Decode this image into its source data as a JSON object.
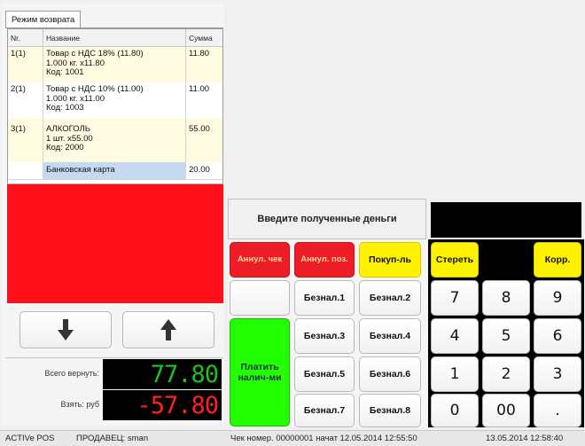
{
  "window": {
    "tab_label": "Режим возврата"
  },
  "receipt": {
    "columns": {
      "nr": "Nr.",
      "name": "Название",
      "sum": "Сумма"
    },
    "items": [
      {
        "nr": "1(1)",
        "line1": "Товар с НДС 18% (11.80)",
        "line2": "1.000 кг. x11.80",
        "line3": "Код: 1001",
        "sum": "11.80"
      },
      {
        "nr": "2(1)",
        "line1": "Товар с НДС 10% (11.00)",
        "line2": "1.000 кг. x11.00",
        "line3": "Код: 1003",
        "sum": "11.00"
      },
      {
        "nr": "3(1)",
        "line1": "АЛКОГОЛЬ",
        "line2": "1 шт. x55.00",
        "line3": "Код: 2000",
        "sum": "55.00"
      }
    ],
    "payment": {
      "name": "Банковская карта",
      "sum": "20.00"
    }
  },
  "totals": {
    "return_label": "Всего вернуть:",
    "return_value": "77.80",
    "take_label": "Взять: руб",
    "take_value": "-57.80"
  },
  "prompt": "Введите полученные деньги",
  "buttons": {
    "cancel_check": "Аннул. чек",
    "cancel_pos": "Аннул. поз.",
    "customer": "Покуп-ль",
    "cashless1": "Безнал.1",
    "cashless2": "Безнал.2",
    "cashless3": "Безнал.3",
    "cashless4": "Безнал.4",
    "cashless5": "Безнал.5",
    "cashless6": "Безнал.6",
    "cashless7": "Безнал.7",
    "cashless8": "Безнал.8",
    "pay_cash": "Платить налич-ми"
  },
  "keypad": {
    "clear": "Стереть",
    "correct": "Корр.",
    "k7": "7",
    "k8": "8",
    "k9": "9",
    "k4": "4",
    "k5": "5",
    "k6": "6",
    "k1": "1",
    "k2": "2",
    "k3": "3",
    "k0": "0",
    "k00": "00",
    "kdot": "."
  },
  "status": {
    "app": "ACTIVe POS",
    "seller": "ПРОДАВЕЦ: sman",
    "check": "Чек номер. 00000001 начат 12.05.2014 12:55:50",
    "datetime": "13.05.2014 12:58:40"
  },
  "colors": {
    "alert_red": "#ff0f1a",
    "digits_green": "#1ec01e",
    "cash_green": "#22ff00",
    "action_yellow": "#fff200"
  },
  "icons": {
    "down": "arrow-down-icon",
    "up": "arrow-up-icon"
  }
}
